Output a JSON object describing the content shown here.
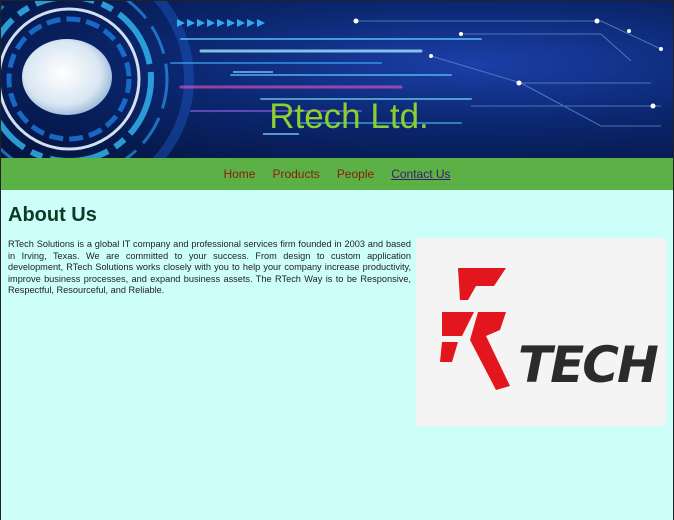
{
  "header": {
    "title": "Rtech Ltd."
  },
  "nav": {
    "items": [
      {
        "label": "Home"
      },
      {
        "label": "Products"
      },
      {
        "label": "People"
      },
      {
        "label": "Contact Us"
      }
    ]
  },
  "main": {
    "heading": "About Us",
    "paragraph": "RTech Solutions is a global IT company and professional services firm founded in 2003 and based in Irving, Texas. We are committed to your success. From design to custom application development, RTech Solutions works closely with you to help your company increase productivity, improve business processes, and expand business assets. The RTech Way is to be Responsive, Respectful, Resourceful, and Reliable.",
    "logo": {
      "text": "TECH",
      "colors": {
        "red": "#e2161c",
        "dark": "#2b2b2b"
      }
    }
  },
  "colors": {
    "nav_bg": "#5bb046",
    "page_bg": "#ccfffa",
    "title": "#8ccf2e",
    "nav_link": "#8b1d0d",
    "nav_active": "#3b1d6b"
  }
}
